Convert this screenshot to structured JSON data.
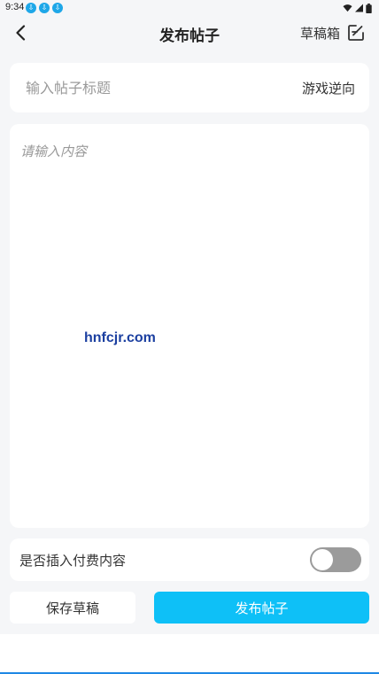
{
  "status_bar": {
    "time": "9:34",
    "notification_icons": [
      "download-icon",
      "download-icon",
      "download-icon"
    ],
    "notification_glyph": "⇩",
    "indicator_icons": [
      "wifi-icon",
      "signal-icon",
      "battery-icon"
    ]
  },
  "app_bar": {
    "back_icon": "chevron-left-icon",
    "title": "发布帖子",
    "drafts_label": "草稿箱",
    "drafts_icon": "edit-icon"
  },
  "form": {
    "title_placeholder": "输入帖子标题",
    "title_value": "",
    "category": "游戏逆向",
    "body_placeholder": "请输入内容",
    "body_value": ""
  },
  "watermark": "hnfcjr.com",
  "paid_content": {
    "label": "是否插入付费内容",
    "enabled": false
  },
  "actions": {
    "save_draft_label": "保存草稿",
    "publish_label": "发布帖子"
  },
  "colors": {
    "page_background": "#f5f6f8",
    "accent": "#0ec0f7",
    "notification_badge": "#1ea7e8",
    "toggle_off": "#9b9b9b",
    "watermark": "#1b3fa0"
  }
}
